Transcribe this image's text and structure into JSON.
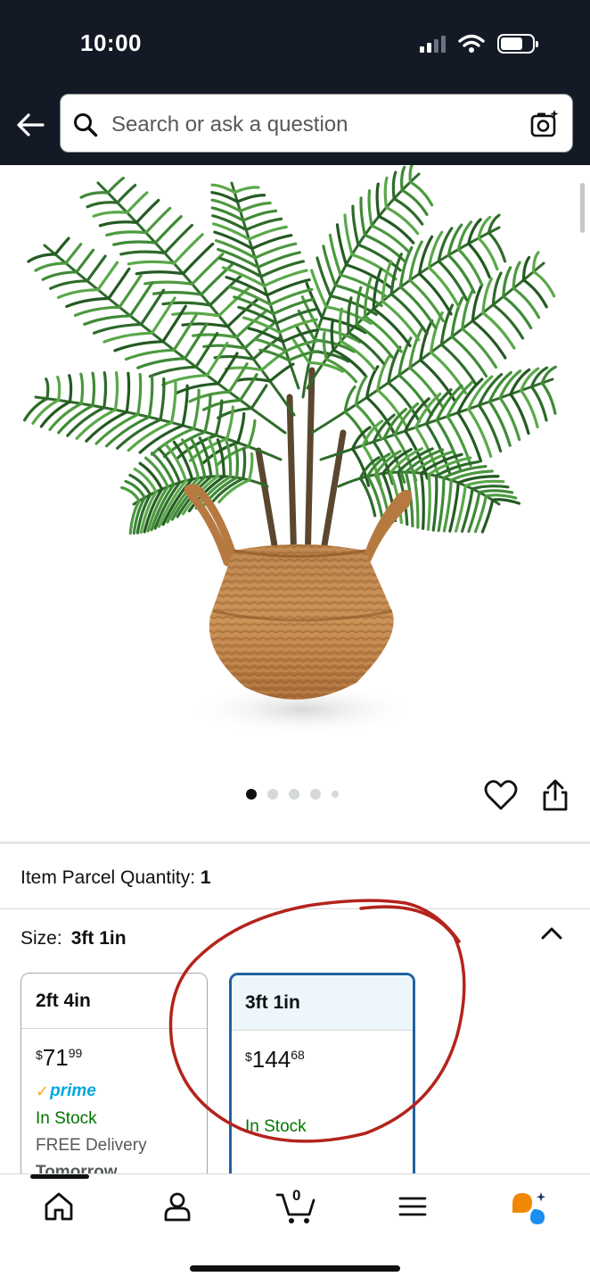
{
  "status_bar": {
    "time": "10:00"
  },
  "header": {
    "search_placeholder": "Search or ask a question"
  },
  "product": {
    "image_alt": "Artificial palm tree in woven seagrass belly basket",
    "carousel": {
      "total": 5,
      "active_index": 0
    }
  },
  "parcel": {
    "label": "Item Parcel Quantity:",
    "value": "1"
  },
  "size": {
    "label": "Size:",
    "selected": "3ft 1in",
    "options": [
      {
        "name": "2ft 4in",
        "price_symbol": "$",
        "price_whole": "71",
        "price_fraction": "99",
        "prime": "prime",
        "stock": "In Stock",
        "delivery": "FREE Delivery",
        "delivery_day": "Tomorrow"
      },
      {
        "name": "3ft 1in",
        "price_symbol": "$",
        "price_whole": "144",
        "price_fraction": "68",
        "stock": "In Stock"
      }
    ]
  },
  "colors": {
    "header_bg": "#131a26",
    "selected_border": "#2162a1",
    "in_stock": "#007600",
    "prime_blue": "#00a8e1",
    "annotation_red": "#b3241c"
  },
  "bottom_nav": {
    "items": [
      "home-icon",
      "account-icon",
      "cart-icon",
      "menu-icon",
      "rufus-icon"
    ],
    "cart_count": "0",
    "active_index": 0
  }
}
